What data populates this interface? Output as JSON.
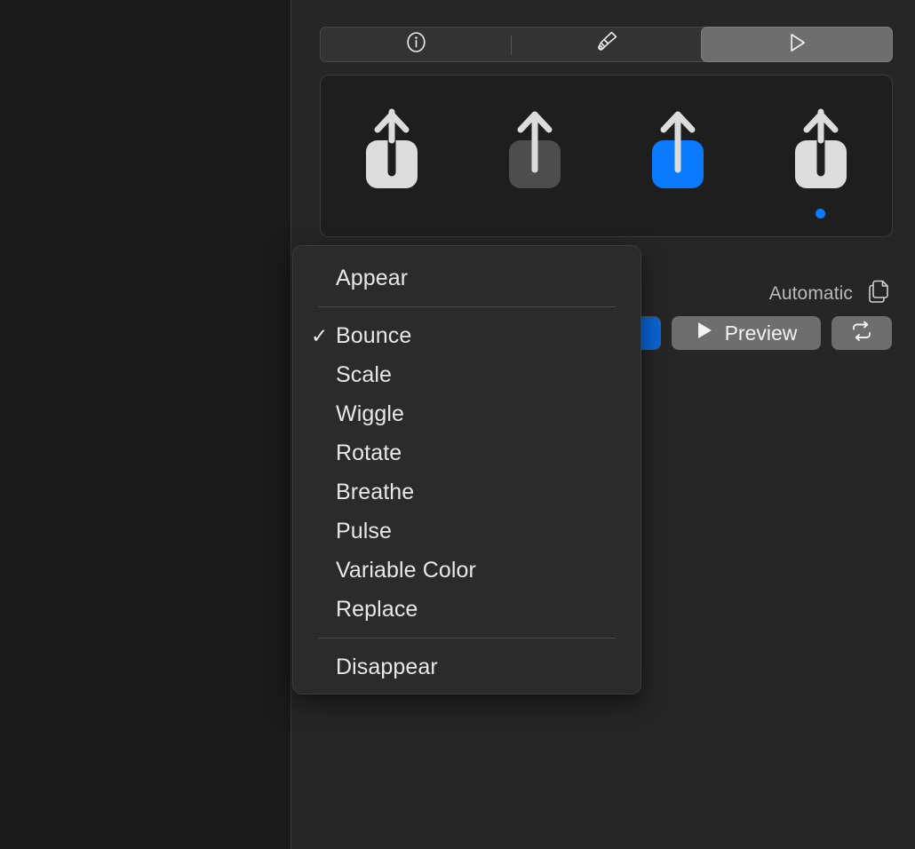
{
  "window": {
    "background_color": "#1a1a1a",
    "panel_color": "#262626",
    "accent_color": "#0a7aff"
  },
  "segmented_control": {
    "segments": [
      {
        "icon": "info-circle-icon",
        "selected": false
      },
      {
        "icon": "paintbrush-icon",
        "selected": false
      },
      {
        "icon": "play-triangle-icon",
        "selected": true
      }
    ]
  },
  "icon_preview": {
    "variants": [
      {
        "name": "share-icon-monochrome",
        "box_color": "#dcdcdc",
        "arrow_color": "#dcdcdc",
        "style": "knockout"
      },
      {
        "name": "share-icon-hierarchical",
        "box_color": "#4d4d4d",
        "arrow_color": "#dcdcdc",
        "style": "overlay"
      },
      {
        "name": "share-icon-palette",
        "box_color": "#0a7aff",
        "arrow_color": "#dcdcdc",
        "style": "overlay"
      },
      {
        "name": "share-icon-multicolor",
        "box_color": "#dcdcdc",
        "arrow_color": "#dcdcdc",
        "style": "knockout"
      }
    ],
    "selected_index": 3,
    "selection_dot_color": "#0a7aff"
  },
  "options": {
    "rendering_label": "Automatic",
    "copy_icon": "copy-documents-icon"
  },
  "actions": {
    "color_swatch_icon": "color-swatch",
    "preview_label": "Preview",
    "preview_icon": "play-triangle-icon",
    "loop_icon": "repeat-loop-icon"
  },
  "menu": {
    "groups": [
      {
        "items": [
          {
            "label": "Appear",
            "checked": false
          }
        ]
      },
      {
        "items": [
          {
            "label": "Bounce",
            "checked": true
          },
          {
            "label": "Scale",
            "checked": false
          },
          {
            "label": "Wiggle",
            "checked": false
          },
          {
            "label": "Rotate",
            "checked": false
          },
          {
            "label": "Breathe",
            "checked": false
          },
          {
            "label": "Pulse",
            "checked": false
          },
          {
            "label": "Variable Color",
            "checked": false
          },
          {
            "label": "Replace",
            "checked": false
          }
        ]
      },
      {
        "items": [
          {
            "label": "Disappear",
            "checked": false
          }
        ]
      }
    ],
    "check_glyph": "✓"
  }
}
